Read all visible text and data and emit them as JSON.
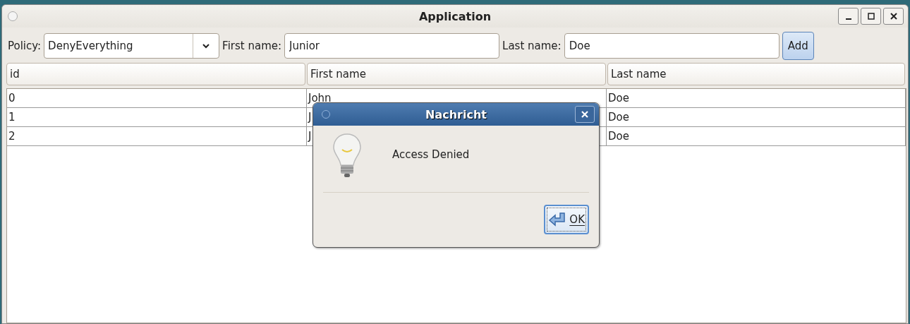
{
  "window": {
    "title": "Application"
  },
  "toolbar": {
    "policy_label": "Policy:",
    "policy_value": "DenyEverything",
    "first_name_label": "First name:",
    "first_name_value": "Junior",
    "last_name_label": "Last name:",
    "last_name_value": "Doe",
    "add_button": "Add"
  },
  "table": {
    "columns": [
      "id",
      "First name",
      "Last name"
    ],
    "rows": [
      [
        "0",
        "John",
        "Doe"
      ],
      [
        "1",
        "J",
        "Doe"
      ],
      [
        "2",
        "J",
        "Doe"
      ]
    ]
  },
  "dialog": {
    "title": "Nachricht",
    "message": "Access Denied",
    "ok_button": "OK"
  }
}
